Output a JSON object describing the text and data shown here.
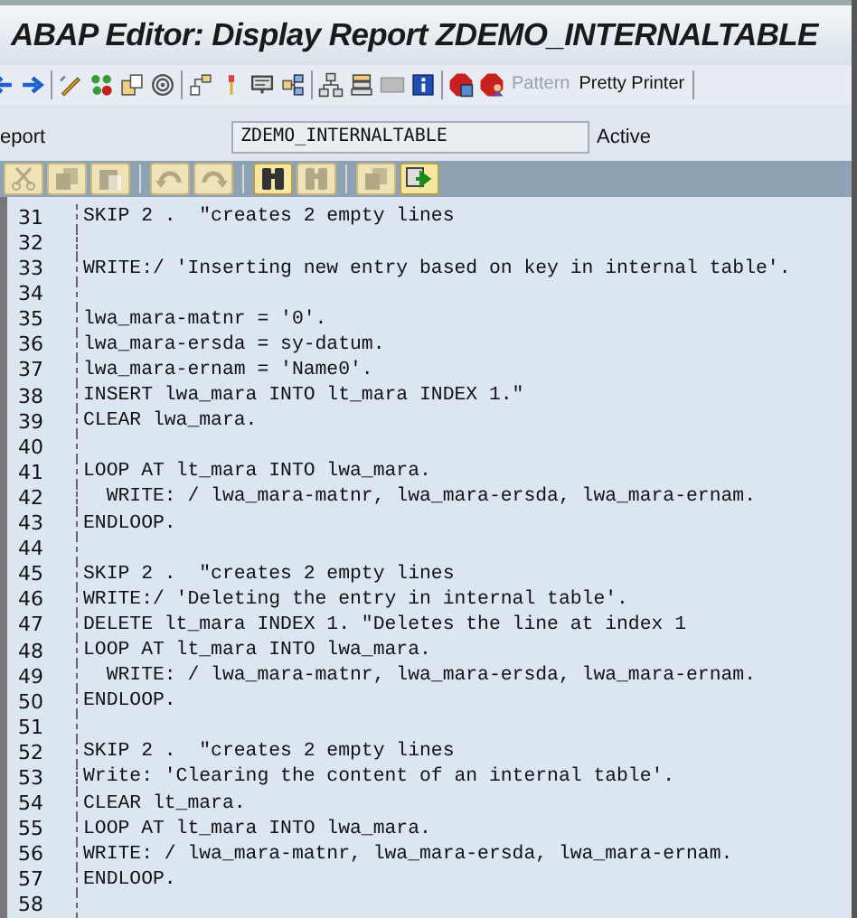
{
  "window": {
    "title": "ABAP Editor: Display Report ZDEMO_INTERNALTABLE"
  },
  "toolbar": {
    "icons": [
      {
        "kind": "back"
      },
      {
        "kind": "forward"
      },
      {
        "kind": "sep"
      },
      {
        "kind": "pencil"
      },
      {
        "kind": "dots"
      },
      {
        "kind": "copy"
      },
      {
        "kind": "spiral"
      },
      {
        "kind": "sep"
      },
      {
        "kind": "hierarchy"
      },
      {
        "kind": "pin"
      },
      {
        "kind": "screen"
      },
      {
        "kind": "network"
      },
      {
        "kind": "sep"
      },
      {
        "kind": "tree"
      },
      {
        "kind": "stack"
      },
      {
        "kind": "panel"
      },
      {
        "kind": "info"
      },
      {
        "kind": "sep"
      },
      {
        "kind": "stop"
      },
      {
        "kind": "stopuser"
      }
    ],
    "buttons": [
      {
        "label": "Pattern",
        "disabled": true
      },
      {
        "label": "Pretty Printer",
        "disabled": false
      }
    ]
  },
  "program": {
    "label": "eport",
    "name": "ZDEMO_INTERNALTABLE",
    "status": "Active"
  },
  "editor_toolbar": [
    {
      "kind": "cut",
      "disabled": true
    },
    {
      "kind": "copy",
      "disabled": true
    },
    {
      "kind": "paste",
      "disabled": true
    },
    {
      "kind": "sep"
    },
    {
      "kind": "undo",
      "disabled": true
    },
    {
      "kind": "redo",
      "disabled": true
    },
    {
      "kind": "sep"
    },
    {
      "kind": "find",
      "disabled": false
    },
    {
      "kind": "findnext",
      "disabled": true
    },
    {
      "kind": "sep"
    },
    {
      "kind": "copyblock",
      "disabled": true
    },
    {
      "kind": "insert",
      "disabled": false
    }
  ],
  "code_lines": [
    {
      "number": "31",
      "text": "SKIP 2 .  \"creates 2 empty lines"
    },
    {
      "number": "32"
    },
    {
      "number": "33",
      "text": "WRITE:/ 'Inserting new entry based on key in internal table'."
    },
    {
      "number": "34"
    },
    {
      "number": "35",
      "text": "lwa_mara-matnr = '0'."
    },
    {
      "number": "36",
      "text": "lwa_mara-ersda = sy-datum."
    },
    {
      "number": "37",
      "text": "lwa_mara-ernam = 'Name0'."
    },
    {
      "number": "38",
      "text": "INSERT lwa_mara INTO lt_mara INDEX 1.\""
    },
    {
      "number": "39",
      "text": "CLEAR lwa_mara."
    },
    {
      "number": "40"
    },
    {
      "number": "41",
      "text": "LOOP AT lt_mara INTO lwa_mara."
    },
    {
      "number": "42",
      "text": "  WRITE: / lwa_mara-matnr, lwa_mara-ersda, lwa_mara-ernam."
    },
    {
      "number": "43",
      "text": "ENDLOOP."
    },
    {
      "number": "44"
    },
    {
      "number": "45",
      "text": "SKIP 2 .  \"creates 2 empty lines"
    },
    {
      "number": "46",
      "text": "WRITE:/ 'Deleting the entry in internal table'."
    },
    {
      "number": "47",
      "text": "DELETE lt_mara INDEX 1. \"Deletes the line at index 1"
    },
    {
      "number": "48",
      "text": "LOOP AT lt_mara INTO lwa_mara."
    },
    {
      "number": "49",
      "text": "  WRITE: / lwa_mara-matnr, lwa_mara-ersda, lwa_mara-ernam."
    },
    {
      "number": "50",
      "text": "ENDLOOP."
    },
    {
      "number": "51"
    },
    {
      "number": "52",
      "text": "SKIP 2 .  \"creates 2 empty lines"
    },
    {
      "number": "53",
      "text": "Write: 'Clearing the content of an internal table'."
    },
    {
      "number": "54",
      "text": "CLEAR lt_mara."
    },
    {
      "number": "55",
      "text": "LOOP AT lt_mara INTO lwa_mara."
    },
    {
      "number": "56",
      "text": "WRITE: / lwa_mara-matnr, lwa_mara-ersda, lwa_mara-ernam."
    },
    {
      "number": "57",
      "text": "ENDLOOP."
    },
    {
      "number": "58"
    }
  ]
}
